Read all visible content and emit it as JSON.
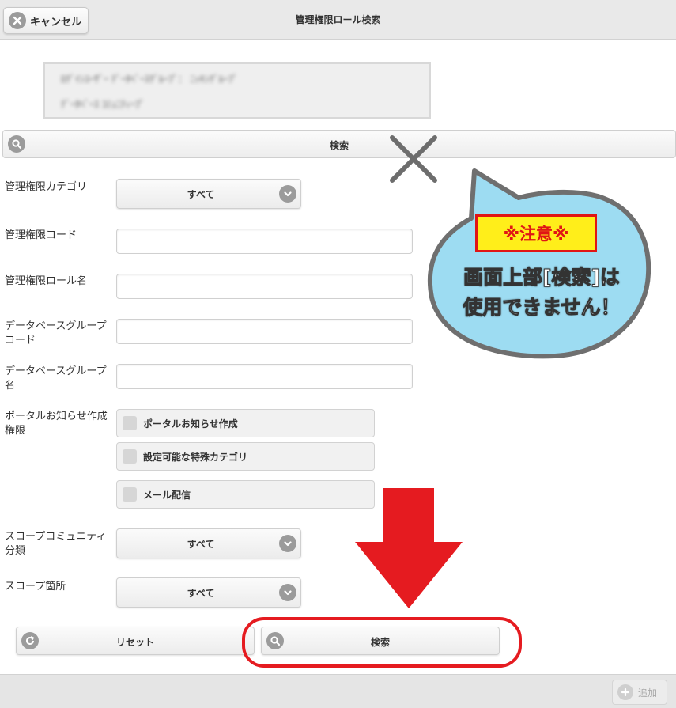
{
  "header": {
    "title": "管理権限ロール検索",
    "cancel_label": "キャンセル",
    "cancel_icon": "close-circle-icon"
  },
  "redacted_info": {
    "line1": "ﾛｸﾞｲﾝﾕｰｻﾞｰ  ﾃﾞｰﾀﾍﾞｰｽｸﾞﾙｰﾌﾟ：  ﾆｯｷﾝｸﾞﾙｰﾌﾟ",
    "line2": "ﾃﾞｰﾀﾍﾞｰｽ  ｺﾐｭﾆﾃｨｰﾌﾟ"
  },
  "top_search": {
    "label": "検索",
    "icon": "search-icon"
  },
  "form": {
    "category": {
      "label": "管理権限カテゴリ",
      "value": "すべて"
    },
    "code": {
      "label": "管理権限コード",
      "value": ""
    },
    "role_name": {
      "label": "管理権限ロール名",
      "value": ""
    },
    "db_group_code": {
      "label": "データベースグループコード",
      "value": ""
    },
    "db_group_name": {
      "label": "データベースグループ名",
      "value": ""
    },
    "portal_permission": {
      "label": "ポータルお知らせ作成権限",
      "options": [
        "ポータルお知らせ作成",
        "設定可能な特殊カテゴリ",
        "メール配信"
      ]
    },
    "scope_community": {
      "label": "スコープコミュニティ分類",
      "value": "すべて"
    },
    "scope_location": {
      "label": "スコープ箇所",
      "value": "すべて"
    }
  },
  "annotation": {
    "note_title": "※注意※",
    "note_line1": "画面上部[検索]は",
    "note_line2": "使用できません！",
    "bubble_color": "#9ddcf2",
    "arrow_color": "#e51b20"
  },
  "actions": {
    "reset_label": "リセット",
    "reset_icon": "refresh-icon",
    "search_label": "検索",
    "search_icon": "search-icon"
  },
  "footer": {
    "add_label": "追加",
    "add_icon": "plus-circle-icon"
  }
}
